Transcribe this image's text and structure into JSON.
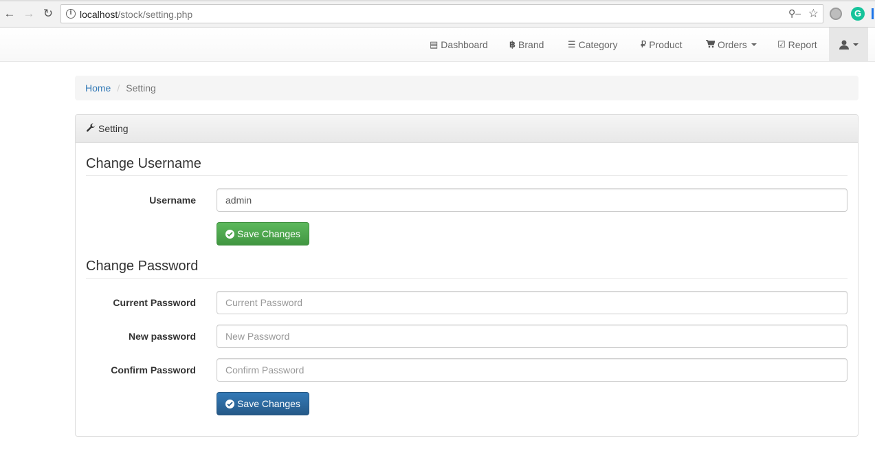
{
  "browser": {
    "url_host": "localhost",
    "url_path": "/stock/setting.php"
  },
  "navbar": {
    "items": [
      {
        "label": "Dashboard",
        "icon": "list-alt-icon"
      },
      {
        "label": "Brand",
        "icon": "bitcoin-icon"
      },
      {
        "label": "Category",
        "icon": "th-list-icon"
      },
      {
        "label": "Product",
        "icon": "ruble-icon"
      },
      {
        "label": "Orders",
        "icon": "shopping-cart-icon"
      },
      {
        "label": "Report",
        "icon": "check-icon"
      }
    ],
    "user_icon": "user-icon"
  },
  "breadcrumb": {
    "home": "Home",
    "current": "Setting"
  },
  "panel": {
    "heading": "Setting",
    "heading_icon": "wrench-icon"
  },
  "username_section": {
    "title": "Change Username",
    "label": "Username",
    "value": "admin",
    "button": "Save Changes"
  },
  "password_section": {
    "title": "Change Password",
    "current_label": "Current Password",
    "current_placeholder": "Current Password",
    "new_label": "New password",
    "new_placeholder": "New Password",
    "confirm_label": "Confirm Password",
    "confirm_placeholder": "Confirm Password",
    "button": "Save Changes"
  },
  "colors": {
    "success": "#5cb85c",
    "primary": "#337ab7",
    "link": "#337ab7"
  }
}
